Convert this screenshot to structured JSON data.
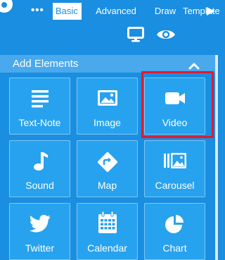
{
  "tabs": {
    "more_label": "•••",
    "basic": "Basic",
    "advanced": "Advanced",
    "draw": "Draw",
    "template": "Template"
  },
  "toolbar": {
    "icons": [
      "monitor-icon",
      "eye-icon"
    ]
  },
  "section": {
    "title": "Add Elements",
    "collapse_icon": "chevron-up-icon"
  },
  "elements": [
    {
      "label": "Text-Note",
      "icon": "text-lines-icon"
    },
    {
      "label": "Image",
      "icon": "image-icon"
    },
    {
      "label": "Video",
      "icon": "video-camera-icon",
      "highlighted": true
    },
    {
      "label": "Sound",
      "icon": "music-note-icon"
    },
    {
      "label": "Map",
      "icon": "direction-sign-icon"
    },
    {
      "label": "Carousel",
      "icon": "carousel-icon"
    },
    {
      "label": "Twitter",
      "icon": "twitter-bird-icon"
    },
    {
      "label": "Calendar",
      "icon": "calendar-icon"
    },
    {
      "label": "Chart",
      "icon": "pie-chart-icon"
    }
  ],
  "colors": {
    "accent": "#1a8ee0",
    "tile": "#27a2ee",
    "header": "#4aa8ec",
    "highlight": "#e4182b"
  }
}
